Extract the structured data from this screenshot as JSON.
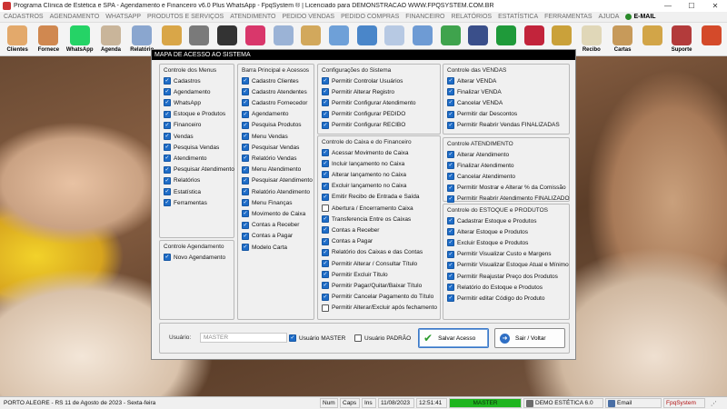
{
  "window": {
    "title": "Programa Clínica de Estética e SPA - Agendamento e Financeiro v6.0 Plus WhatsApp - FpqSystem ® | Licenciado para  DEMONSTRACAO WWW.FPQSYSTEM.COM.BR",
    "minimize": "—",
    "maximize": "☐",
    "close": "✕"
  },
  "menu": [
    "CADASTROS",
    "AGENDAMENTO",
    "WHATSAPP",
    "PRODUTOS E SERVIÇOS",
    "ATENDIMENTO",
    "PEDIDO VENDAS",
    "PEDIDO COMPRAS",
    "FINANCEIRO",
    "RELATÓRIOS",
    "ESTATÍSTICA",
    "FERRAMENTAS",
    "AJUDA"
  ],
  "menu_email": "E-MAIL",
  "toolbar": [
    {
      "label": "Clientes",
      "color": "#e3a96b"
    },
    {
      "label": "Fornece",
      "color": "#d08850"
    },
    {
      "label": "WhatsApp",
      "color": "#25d366"
    },
    {
      "label": "Agenda",
      "color": "#c9b59a"
    },
    {
      "label": "Relatório",
      "color": "#8aa6cf"
    },
    {
      "label": "",
      "color": "#d9a648"
    },
    {
      "label": "",
      "color": "#7a7a7a"
    },
    {
      "label": "",
      "color": "#333333"
    },
    {
      "label": "",
      "color": "#d9376b"
    },
    {
      "label": "",
      "color": "#9bb3d6"
    },
    {
      "label": "",
      "color": "#d2a85c"
    },
    {
      "label": "",
      "color": "#6ea0d8"
    },
    {
      "label": "",
      "color": "#4a86c9"
    },
    {
      "label": "",
      "color": "#b7c9e3"
    },
    {
      "label": "",
      "color": "#6e9bd4"
    },
    {
      "label": "",
      "color": "#3fa34d"
    },
    {
      "label": "",
      "color": "#3a4f8a"
    },
    {
      "label": "",
      "color": "#1f9a3a"
    },
    {
      "label": "",
      "color": "#c2243b"
    },
    {
      "label": "",
      "color": "#caa13a"
    },
    {
      "label": "Recibo",
      "color": "#e0d7b8"
    },
    {
      "label": "Cartas",
      "color": "#c79a5a"
    },
    {
      "label": "",
      "color": "#d2a548"
    },
    {
      "label": "Suporte",
      "color": "#b33b3b"
    },
    {
      "label": "",
      "color": "#d44a2a"
    }
  ],
  "dialog": {
    "title": "MAPA DE ACESSO AO SISTEMA",
    "groups": {
      "menus": {
        "title": "Controle dos Menus",
        "items": [
          {
            "label": "Cadastros",
            "checked": true
          },
          {
            "label": "Agendamento",
            "checked": true
          },
          {
            "label": "WhatsApp",
            "checked": true
          },
          {
            "label": "Estoque e Produtos",
            "checked": true
          },
          {
            "label": "Financeiro",
            "checked": true
          },
          {
            "label": "Vendas",
            "checked": true
          },
          {
            "label": "Pesquisa Vendas",
            "checked": true
          },
          {
            "label": "Atendimento",
            "checked": true
          },
          {
            "label": "Pesquisar Atendimento",
            "checked": true
          },
          {
            "label": "Relatórios",
            "checked": true
          },
          {
            "label": "Estatística",
            "checked": true
          },
          {
            "label": "Ferramentas",
            "checked": true
          }
        ]
      },
      "agendamento": {
        "title": "Controle Agendamento",
        "items": [
          {
            "label": "Novo Agendamento",
            "checked": true
          }
        ]
      },
      "barra": {
        "title": "Barra Principal e Acessos",
        "items": [
          {
            "label": "Cadastro Clientes",
            "checked": true
          },
          {
            "label": "Cadastro Atendentes",
            "checked": true
          },
          {
            "label": "Cadastro Fornecedor",
            "checked": true
          },
          {
            "label": "Agendamento",
            "checked": true
          },
          {
            "label": "Pesquisa Produtos",
            "checked": true
          },
          {
            "label": "Menu Vendas",
            "checked": true
          },
          {
            "label": "Pesquisar Vendas",
            "checked": true
          },
          {
            "label": "Relatório Vendas",
            "checked": true
          },
          {
            "label": "Menu Atendimento",
            "checked": true
          },
          {
            "label": "Pesquisar Atendimento",
            "checked": true
          },
          {
            "label": "Relatório Atendimento",
            "checked": true
          },
          {
            "label": "Menu Finanças",
            "checked": true
          },
          {
            "label": "Movimento de Caixa",
            "checked": true
          },
          {
            "label": "Contas a Receber",
            "checked": true
          },
          {
            "label": "Contas a Pagar",
            "checked": true
          },
          {
            "label": "Modelo Carta",
            "checked": true
          }
        ]
      },
      "config": {
        "title": "Configurações do Sistema",
        "items": [
          {
            "label": "Permitir Controlar Usuários",
            "checked": true
          },
          {
            "label": "Permitir Alterar Registro",
            "checked": true
          },
          {
            "label": "Permitir Configurar Atendimento",
            "checked": true
          },
          {
            "label": "Permitir Configurar PEDIDO",
            "checked": true
          },
          {
            "label": "Permitir Configurar RECIBO",
            "checked": true
          }
        ]
      },
      "caixa": {
        "title": "Controle do Caixa e do Financeiro",
        "items": [
          {
            "label": "Acessar Movimento de Caixa",
            "checked": true
          },
          {
            "label": "Incluir lançamento no Caixa",
            "checked": true
          },
          {
            "label": "Alterar lançamento no Caixa",
            "checked": true
          },
          {
            "label": "Excluir lançamento no Caixa",
            "checked": true
          },
          {
            "label": "Emitir Recibo de Entrada e Saída",
            "checked": true
          },
          {
            "label": "Abertura / Encerramento Caixa",
            "checked": false
          },
          {
            "label": "Transferencia Entre os Caixas",
            "checked": true
          },
          {
            "label": "Contas a Receber",
            "checked": true
          },
          {
            "label": "Contas a Pagar",
            "checked": true
          },
          {
            "label": "Relatório dos Caixas e das Contas",
            "checked": true
          },
          {
            "label": "Permitir Alterar / Consultar Título",
            "checked": true
          },
          {
            "label": "Permitir Excluir Título",
            "checked": true
          },
          {
            "label": "Permitir Pagar/Quitar/Baixar Título",
            "checked": true
          },
          {
            "label": "Permitir Cancelar Pagamento do Título",
            "checked": true
          },
          {
            "label": "Permitir Alterar/Excluir após fechamento",
            "checked": false
          }
        ]
      },
      "vendas": {
        "title": "Controle das VENDAS",
        "items": [
          {
            "label": "Alterar VENDA",
            "checked": true
          },
          {
            "label": "Finalizar VENDA",
            "checked": true
          },
          {
            "label": "Cancelar VENDA",
            "checked": true
          },
          {
            "label": "Permitir dar Descontos",
            "checked": true
          },
          {
            "label": "Permitir Reabrir Vendas FINALIZADAS",
            "checked": true
          }
        ]
      },
      "atendimento": {
        "title": "Controle ATENDIMENTO",
        "items": [
          {
            "label": "Alterar Atendimento",
            "checked": true
          },
          {
            "label": "Finalizar Atendimento",
            "checked": true
          },
          {
            "label": "Cancelar Atendimento",
            "checked": true
          },
          {
            "label": "Permitir Mostrar e Alterar % da Comissão",
            "checked": true
          },
          {
            "label": "Permitir Reabrir Atendimento FINALIZADO",
            "checked": true
          }
        ]
      },
      "estoque": {
        "title": "Controle do ESTOQUE e PRODUTOS",
        "items": [
          {
            "label": "Cadastrar Estoque e Produtos",
            "checked": true
          },
          {
            "label": "Alterar Estoque e Produtos",
            "checked": true
          },
          {
            "label": "Excluir Estoque e Produtos",
            "checked": true
          },
          {
            "label": "Permitir Visualizar Custo e Margens",
            "checked": true
          },
          {
            "label": "Permitir Visualizar Estoque Atual e Mínimo",
            "checked": true
          },
          {
            "label": "Permitir Reajustar Preço dos Produtos",
            "checked": true
          },
          {
            "label": "Relatório do Estoque e Produtos",
            "checked": true
          },
          {
            "label": "Permitir editar Código do Produto",
            "checked": true
          }
        ]
      }
    },
    "usuario_label": "Usuário:",
    "usuario_value": "MASTER",
    "usuario_master": {
      "label": "Usuário MASTER",
      "checked": true
    },
    "usuario_padrao": {
      "label": "Usuário PADRÃO",
      "checked": false
    },
    "save_label": "Salvar Acesso",
    "exit_label": "Sair / Voltar"
  },
  "status": {
    "location": "PORTO ALEGRE - RS 11 de Agosto de 2023 - Sexta-feira",
    "num": "Num",
    "caps": "Caps",
    "ins": "Ins",
    "date": "11/08/2023",
    "time": "12:51:41",
    "user": "MASTER",
    "edition": "DEMO ESTÉTICA 6.0",
    "email": "Email",
    "brand": "FpqSystem"
  }
}
